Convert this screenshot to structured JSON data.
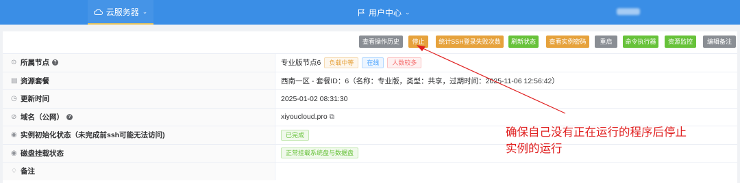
{
  "nav": {
    "cloud_label": "云服务器",
    "user_label": "用户中心"
  },
  "toolbar": {
    "buttons": [
      {
        "label": "查看操作历史",
        "color": "#8a8e94"
      },
      {
        "label": "停止",
        "color": "#e6a23c"
      },
      {
        "label": "统计SSH登录失败次数",
        "color": "#e6a23c"
      },
      {
        "label": "刷新状态",
        "color": "#67c23a"
      },
      {
        "label": "查看实例密码",
        "color": "#e6a23c"
      },
      {
        "label": "重启",
        "color": "#8a8e94"
      },
      {
        "label": "命令执行器",
        "color": "#67c23a"
      },
      {
        "label": "资源监控",
        "color": "#67c23a"
      },
      {
        "label": "编辑备注",
        "color": "#8a8e94"
      }
    ]
  },
  "rows": [
    {
      "label": "所属节点",
      "icon": "location-icon",
      "value": "专业版节点6",
      "tags": [
        "负载中等",
        "在线",
        "人数较多"
      ]
    },
    {
      "label": "资源套餐",
      "icon": "package-icon",
      "value": "西南一区 - 套餐ID：6（名称：专业版，类型：共享，过期时间：2025-11-06 12:56:42）"
    },
    {
      "label": "更新时间",
      "icon": "clock-icon",
      "value": "2025-01-02 08:31:30"
    },
    {
      "label": "域名（公网）",
      "icon": "link-icon",
      "value": "xiyoucloud.pro"
    },
    {
      "label": "实例初始化状态（未完成前ssh可能无法访问)",
      "icon": "eye-icon",
      "tag": "已完成"
    },
    {
      "label": "磁盘挂载状态",
      "icon": "eye-icon",
      "tag": "正常挂载系统盘与数据盘"
    },
    {
      "label": "备注",
      "icon": "bell-icon",
      "value": ""
    }
  ],
  "annotation": {
    "line1": "确保自己没有正在运行的程序后停止",
    "line2": "实例的运行",
    "color": "#e02020"
  }
}
